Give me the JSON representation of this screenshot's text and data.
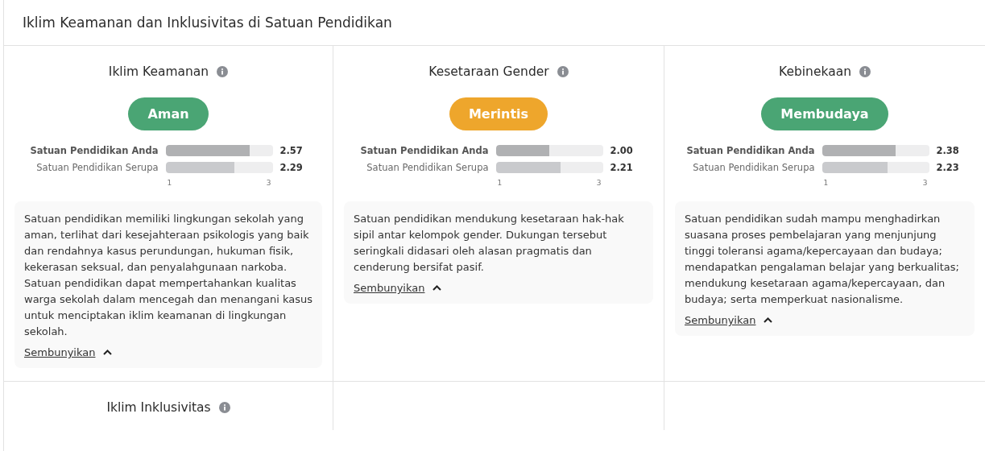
{
  "page_title": "Iklim Keamanan dan Inklusivitas di Satuan Pendidikan",
  "sections": [
    {
      "title": "Iklim Keamanan",
      "status": "Aman",
      "color": "#4aa574",
      "rows": [
        {
          "label": "Satuan Pendidikan Anda",
          "kind": "own",
          "level": 0.785,
          "value": "2.57"
        },
        {
          "label": "Satuan Pendidikan Serupa",
          "kind": "peer",
          "level": 0.645,
          "value": "2.29"
        }
      ],
      "ticks": [
        "1",
        "3"
      ],
      "description": "Satuan pendidikan memiliki lingkungan sekolah yang aman, terlihat dari kesejahteraan psikologis yang baik dan rendahnya kasus perundungan, hukuman fisik, kekerasan seksual, dan penyalahgunaan narkoba. Satuan pendidikan dapat mempertahankan kualitas warga sekolah dalam mencegah dan menangani kasus untuk menciptakan iklim keamanan di lingkungan sekolah.",
      "toggle": "Sembunyikan",
      "expanded": true
    },
    {
      "title": "Kesetaraan Gender",
      "status": "Merintis",
      "color": "#eea62c",
      "rows": [
        {
          "label": "Satuan Pendidikan Anda",
          "kind": "own",
          "level": 0.5,
          "value": "2.00"
        },
        {
          "label": "Satuan Pendidikan Serupa",
          "kind": "peer",
          "level": 0.605,
          "value": "2.21"
        }
      ],
      "ticks": [
        "1",
        "3"
      ],
      "description": "Satuan pendidikan mendukung kesetaraan hak-hak sipil antar kelompok gender. Dukungan tersebut seringkali didasari oleh alasan pragmatis dan cenderung bersifat pasif.",
      "toggle": "Sembunyikan",
      "expanded": true
    },
    {
      "title": "Kebinekaan",
      "status": "Membudaya",
      "color": "#4aa574",
      "rows": [
        {
          "label": "Satuan Pendidikan Anda",
          "kind": "own",
          "level": 0.69,
          "value": "2.38"
        },
        {
          "label": "Satuan Pendidikan Serupa",
          "kind": "peer",
          "level": 0.615,
          "value": "2.23"
        }
      ],
      "ticks": [
        "1",
        "3"
      ],
      "description": "Satuan pendidikan sudah mampu menghadirkan suasana proses pembelajaran yang menjunjung tinggi toleransi agama/kepercayaan dan budaya; mendapatkan pengalaman belajar yang berkualitas; mendukung kesetaraan agama/kepercayaan, dan budaya; serta memperkuat nasionalisme.",
      "toggle": "Sembunyikan",
      "expanded": true
    },
    {
      "title": "Iklim Inklusivitas"
    }
  ]
}
